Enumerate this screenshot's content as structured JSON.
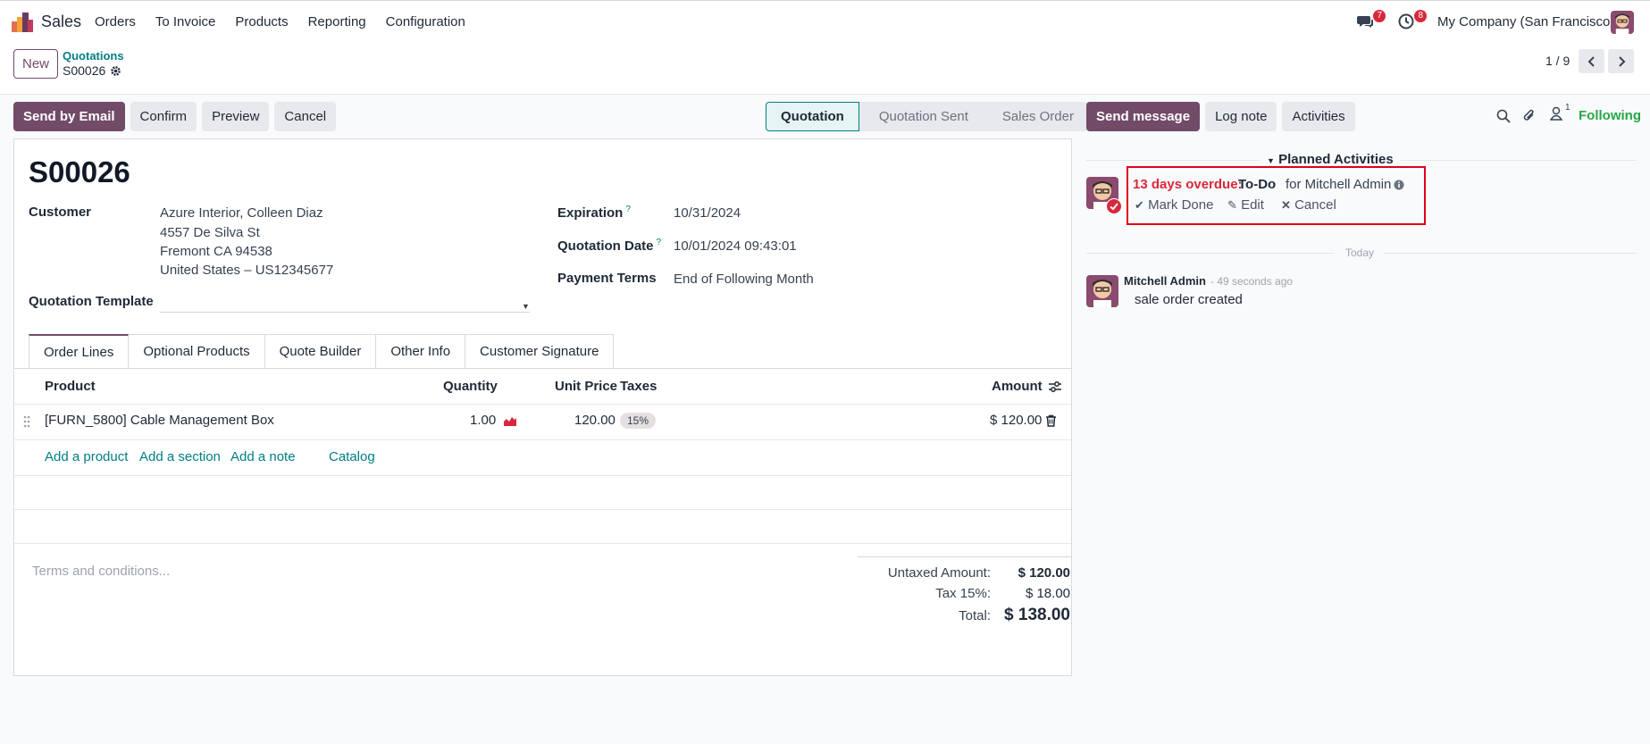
{
  "nav": {
    "app_name": "Sales",
    "menu": [
      "Orders",
      "To Invoice",
      "Products",
      "Reporting",
      "Configuration"
    ],
    "messages_count": "7",
    "activities_count": "8",
    "company": "My Company (San Francisco)"
  },
  "control": {
    "new_label": "New",
    "breadcrumb_parent": "Quotations",
    "breadcrumb_current": "S00026",
    "pager": "1 / 9"
  },
  "actions": {
    "send_email": "Send by Email",
    "confirm": "Confirm",
    "preview": "Preview",
    "cancel": "Cancel"
  },
  "status": {
    "stages": [
      "Quotation",
      "Quotation Sent",
      "Sales Order"
    ],
    "active": "Quotation"
  },
  "form": {
    "reference": "S00026",
    "customer_label": "Customer",
    "customer_lines": [
      "Azure Interior, Colleen Diaz",
      "4557 De Silva St",
      "Fremont CA 94538",
      "United States – US12345677"
    ],
    "expiration_label": "Expiration",
    "expiration": "10/31/2024",
    "quotation_date_label": "Quotation Date",
    "quotation_date": "10/01/2024 09:43:01",
    "payment_terms_label": "Payment Terms",
    "payment_terms": "End of Following Month",
    "template_label": "Quotation Template",
    "help_mark": "?"
  },
  "tabs": [
    "Order Lines",
    "Optional Products",
    "Quote Builder",
    "Other Info",
    "Customer Signature"
  ],
  "table": {
    "headers": {
      "product": "Product",
      "quantity": "Quantity",
      "unit_price": "Unit Price",
      "taxes": "Taxes",
      "amount": "Amount"
    },
    "rows": [
      {
        "product": "[FURN_5800] Cable Management Box",
        "quantity": "1.00",
        "unit_price": "120.00",
        "tax": "15%",
        "amount": "$ 120.00"
      }
    ],
    "add_product": "Add a product",
    "add_section": "Add a section",
    "add_note": "Add a note",
    "catalog": "Catalog"
  },
  "terms_placeholder": "Terms and conditions...",
  "totals": {
    "untaxed_label": "Untaxed Amount:",
    "untaxed": "$ 120.00",
    "tax_label": "Tax 15%:",
    "tax": "$ 18.00",
    "total_label": "Total:",
    "total": "$ 138.00"
  },
  "chatter": {
    "send_message": "Send message",
    "log_note": "Log note",
    "activities": "Activities",
    "followers_count": "1",
    "following": "Following",
    "planned_title": "Planned Activities",
    "overdue": "13 days overdue:",
    "activity_type": "To-Do",
    "activity_for": "for Mitchell Admin",
    "mark_done": "Mark Done",
    "edit": "Edit",
    "cancel": "Cancel",
    "today": "Today",
    "message_author": "Mitchell Admin",
    "message_time": "- 49 seconds ago",
    "message_body": "sale order created"
  },
  "colors": {
    "primary": "#714b67",
    "teal": "#017e84",
    "danger": "#d9283b",
    "success": "#28a745"
  }
}
